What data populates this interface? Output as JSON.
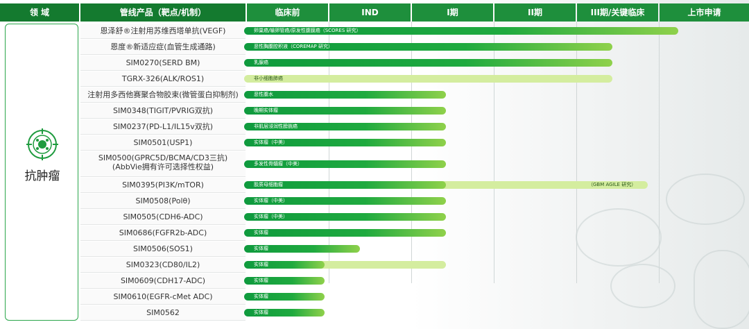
{
  "header": {
    "domain": "领 域",
    "product": "管线产品（靶点/机制）",
    "phases": [
      "临床前",
      "IND",
      "I期",
      "II期",
      "III期/关键临床",
      "上市申请"
    ]
  },
  "domain_label": "抗肿瘤",
  "rows": [
    {
      "product": "恩泽舒®注射用苏维西塔单抗(VEGF)",
      "label": "卵巢癌/输卵管癌/原发性腹膜癌（SCORES 研究）",
      "progress": 0.86,
      "style": "dark"
    },
    {
      "product": "恩度®新适应症(血管生成通路)",
      "label": "恶性胸腹腔积液（COREMAP 研究）",
      "progress": 0.73,
      "style": "dark"
    },
    {
      "product": "SIM0270(SERD BM)",
      "label": "乳腺癌",
      "progress": 0.73,
      "style": "dark"
    },
    {
      "product": "TGRX-326(ALK/ROS1)",
      "label": "非小细胞肺癌",
      "progress": 0.73,
      "style": "light"
    },
    {
      "product": "注射用多西他赛聚合物胶束(微管蛋白抑制剂)",
      "label": "恶性腹水",
      "progress": 0.4,
      "style": "dark"
    },
    {
      "product": "SIM0348(TIGIT/PVRIG双抗)",
      "label": "晚期实体瘤",
      "progress": 0.4,
      "style": "dark"
    },
    {
      "product": "SIM0237(PD-L1/IL15v双抗)",
      "label": "非肌层浸润性膀胱癌",
      "progress": 0.4,
      "style": "dark"
    },
    {
      "product": "SIM0501(USP1)",
      "label": "实体瘤（中美）",
      "progress": 0.4,
      "style": "dark"
    },
    {
      "product": "SIM0500(GPRC5D/BCMA/CD3三抗)",
      "product2": "(AbbVie拥有许可选择性权益)",
      "label": "多发性骨髓瘤（中美）",
      "progress": 0.4,
      "style": "dark"
    },
    {
      "product": "SIM0395(PI3K/mTOR)",
      "label": "胶质母细胞瘤",
      "progress": 0.4,
      "style": "dark",
      "ext_label": "（GBM AGILE 研究）",
      "ext_progress": 0.8
    },
    {
      "product": "SIM0508(Polθ)",
      "label": "实体瘤（中美）",
      "progress": 0.4,
      "style": "dark"
    },
    {
      "product": "SIM0505(CDH6-ADC)",
      "label": "实体瘤（中美）",
      "progress": 0.4,
      "style": "dark"
    },
    {
      "product": "SIM0686(FGFR2b-ADC)",
      "label": "实体瘤",
      "progress": 0.4,
      "style": "dark"
    },
    {
      "product": "SIM0506(SOS1)",
      "label": "实体瘤",
      "progress": 0.23,
      "style": "dark"
    },
    {
      "product": "SIM0323(CD80/IL2)",
      "label": "实体瘤",
      "progress": 0.16,
      "style": "dark",
      "ext_label": "",
      "ext_progress": 0.4
    },
    {
      "product": "SIM0609(CDH17-ADC)",
      "label": "实体瘤",
      "progress": 0.16,
      "style": "dark"
    },
    {
      "product": "SIM0610(EGFR-cMet ADC)",
      "label": "实体瘤",
      "progress": 0.16,
      "style": "dark"
    },
    {
      "product": "SIM0562",
      "label": "实体瘤",
      "progress": 0.16,
      "style": "dark"
    }
  ]
}
